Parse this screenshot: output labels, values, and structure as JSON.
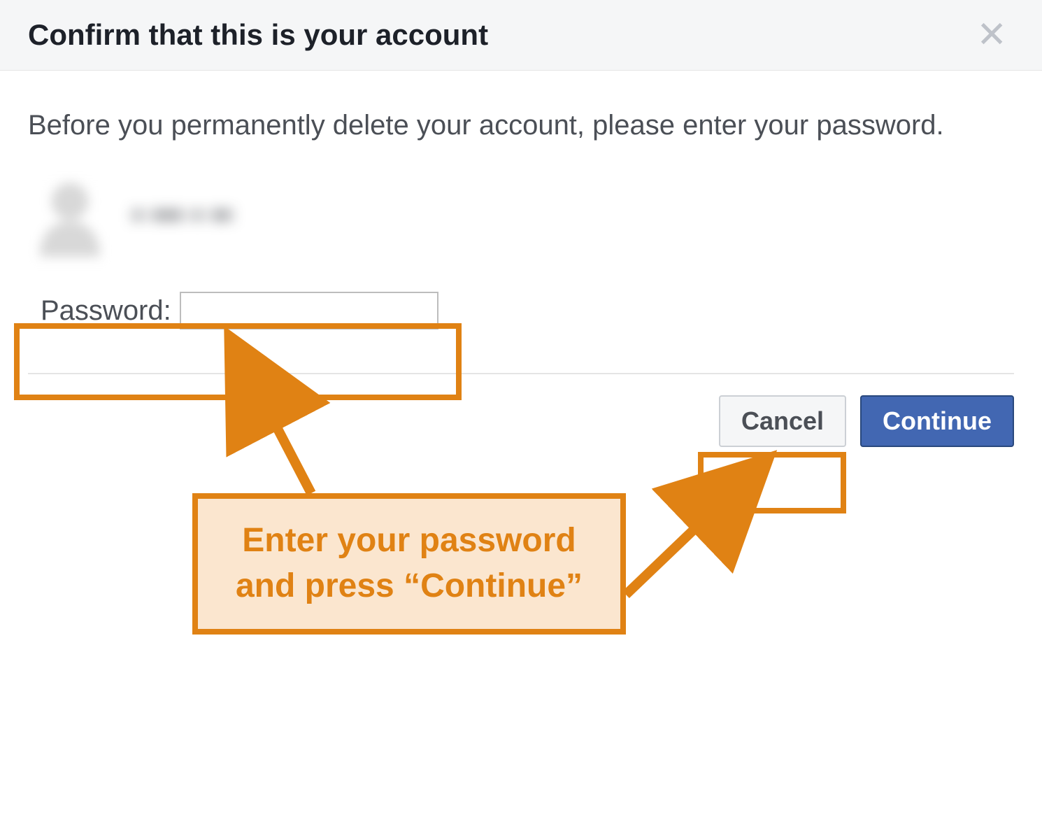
{
  "dialog": {
    "title": "Confirm that this is your account",
    "instruction": "Before you permanently delete your account, please enter your password.",
    "username_obscured": "▪ ▪▪▪ ▪ ▪▪",
    "password_label": "Password:",
    "password_value": "",
    "cancel_label": "Cancel",
    "continue_label": "Continue"
  },
  "annotation": {
    "callout_text": "Enter your password and press “Continue”",
    "highlight_color": "#e08214"
  }
}
